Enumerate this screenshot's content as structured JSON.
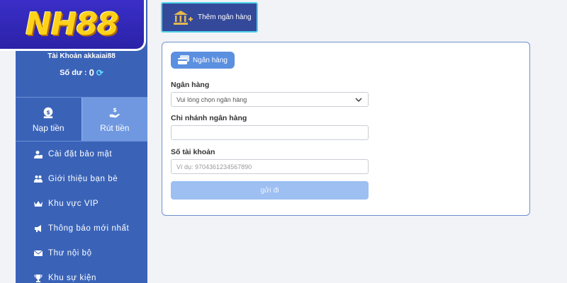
{
  "logo": {
    "text": "NH88"
  },
  "account": {
    "name_line": "Tài Khoản akkaiai88",
    "balance_label": "Số dư :",
    "balance_value": "0"
  },
  "actions": [
    {
      "label": "Nạp tiền",
      "icon": "money-bag-icon"
    },
    {
      "label": "Rút tiền",
      "icon": "withdraw-hand-icon"
    }
  ],
  "menu": [
    {
      "label": "Cài đặt bảo mật",
      "icon": "user-shield-icon"
    },
    {
      "label": "Giới thiệu bạn bè",
      "icon": "users-icon"
    },
    {
      "label": "Khu vực VIP",
      "icon": "crown-icon"
    },
    {
      "label": "Thông báo mới nhất",
      "icon": "megaphone-icon"
    },
    {
      "label": "Thư nội bộ",
      "icon": "mail-icon"
    },
    {
      "label": "Khu sự kiện",
      "icon": "trophy-icon"
    }
  ],
  "add_bank_button": "Thêm ngân hàng",
  "form": {
    "tab_label": "Ngân hàng",
    "bank_label": "Ngân hàng",
    "bank_select_value": "Vui lòng chọn ngân hàng",
    "branch_label": "Chi nhánh ngân hàng",
    "branch_value": "",
    "account_label": "Số tài khoản",
    "account_placeholder": "Ví dụ:  9704361234567890",
    "submit_label": "gửi đi"
  },
  "colors": {
    "sidebar": "#3a63b8",
    "active_action": "#6f98e0",
    "submit": "#9dbff2",
    "logo_gold": "#ffd21a"
  }
}
